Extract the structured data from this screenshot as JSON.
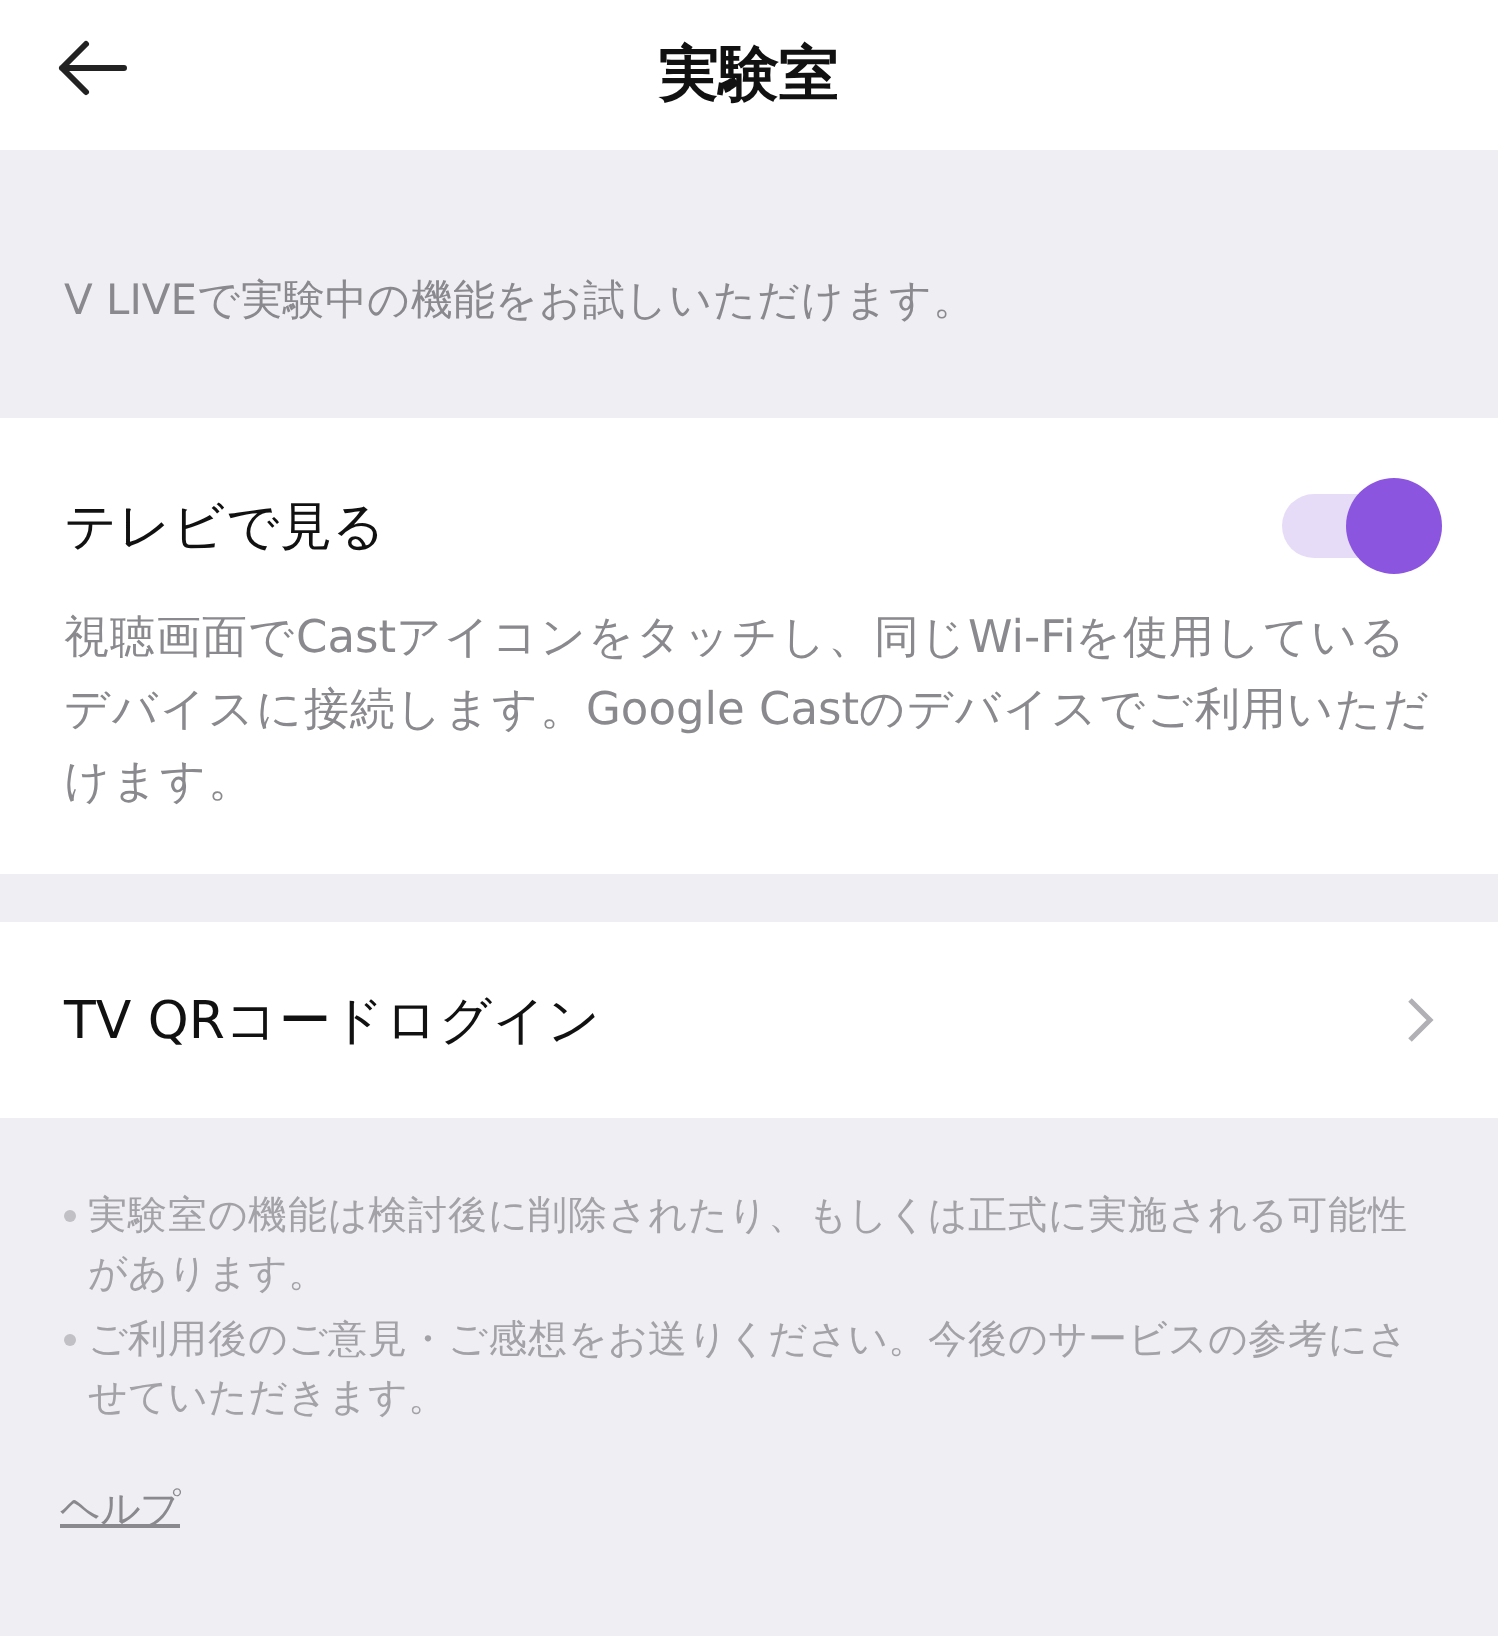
{
  "header": {
    "title": "実験室"
  },
  "intro": "V LIVEで実験中の機能をお試しいただけます。",
  "tv_setting": {
    "label": "テレビで見る",
    "on": true,
    "description": "視聴画面でCastアイコンをタッチし、同じWi-Fiを使用しているデバイスに接続します。Google Castのデバイスでご利用いただけます。"
  },
  "qr_login": {
    "label": "TV QRコードログイン"
  },
  "notes": [
    "実験室の機能は検討後に削除されたり、もしくは正式に実施される可能性があります。",
    "ご利用後のご意見・ご感想をお送りください。今後のサービスの参考にさせていただきます。"
  ],
  "help_link": "ヘルプ"
}
